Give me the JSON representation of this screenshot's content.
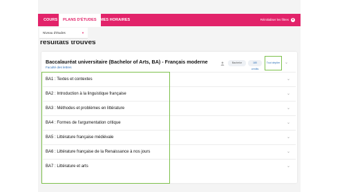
{
  "nav": {
    "tabs": [
      "COURS",
      "PLANS D'ÉTUDES",
      "MES HORAIRES"
    ],
    "active_tab": "PLANS D'ÉTUDES",
    "reset_label": "Réinitialiser les filtres"
  },
  "filter": {
    "label": "Niveau d'études"
  },
  "results": {
    "heading": "résultats trouvés"
  },
  "program": {
    "title": "Baccalauréat universitaire (Bachelor of Arts, BA) - Français moderne",
    "faculty": "Faculté des lettres",
    "level_pill": "Bachelor",
    "credits_pill": "180 crédits",
    "expand_label": "Tout déplier"
  },
  "courses": [
    "BA1 : Textes et contextes",
    "BA2 : Introduction à la linguistique française",
    "BA3 : Méthodes et problèmes en littérature",
    "BA4 : Formes de l'argumentation critique",
    "BA5 : Littérature française médiévale",
    "BA6 : Littérature française de la Renaissance à nos jours",
    "BA7 : Littérature et arts"
  ],
  "colors": {
    "brand": "#e2236a",
    "highlight": "#7cc04b",
    "link": "#2a6fb8"
  }
}
